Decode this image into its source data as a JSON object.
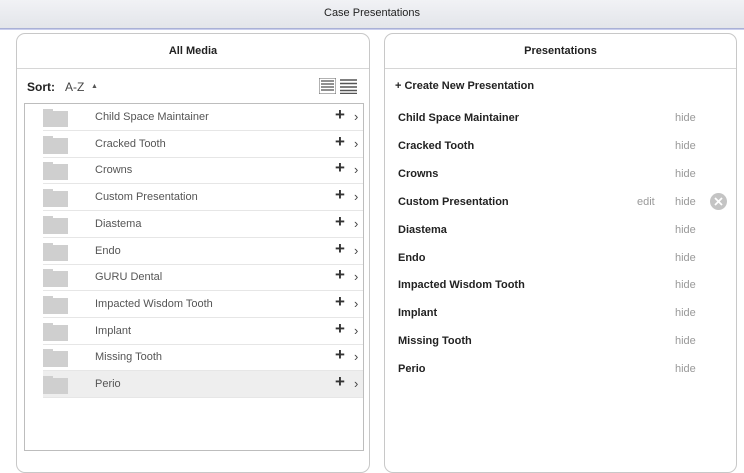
{
  "window": {
    "title": "Case Presentations"
  },
  "left_panel": {
    "title": "All Media",
    "sort_label": "Sort:",
    "sort_value": "A-Z",
    "sort_arrow": "▲",
    "items": [
      {
        "name": "Child Space Maintainer"
      },
      {
        "name": "Cracked Tooth"
      },
      {
        "name": "Crowns"
      },
      {
        "name": "Custom Presentation"
      },
      {
        "name": "Diastema"
      },
      {
        "name": "Endo"
      },
      {
        "name": "GURU Dental"
      },
      {
        "name": "Impacted Wisdom Tooth"
      },
      {
        "name": "Implant"
      },
      {
        "name": "Missing Tooth"
      },
      {
        "name": "Perio",
        "selected": true
      }
    ],
    "add_glyph": "+",
    "chevron_glyph": "›"
  },
  "right_panel": {
    "title": "Presentations",
    "create_label": "+ Create New Presentation",
    "edit_label": "edit",
    "hide_label": "hide",
    "items": [
      {
        "name": "Child Space Maintainer"
      },
      {
        "name": "Cracked Tooth"
      },
      {
        "name": "Crowns"
      },
      {
        "name": "Custom Presentation",
        "editable": true
      },
      {
        "name": "Diastema"
      },
      {
        "name": "Endo"
      },
      {
        "name": "Impacted Wisdom Tooth"
      },
      {
        "name": "Implant"
      },
      {
        "name": "Missing Tooth"
      },
      {
        "name": "Perio"
      }
    ]
  },
  "colors": {
    "folder": "#cfcfcf",
    "selected_row": "#eeeeee",
    "muted_text": "#999999",
    "topbar_border": "#a9b0d6"
  }
}
